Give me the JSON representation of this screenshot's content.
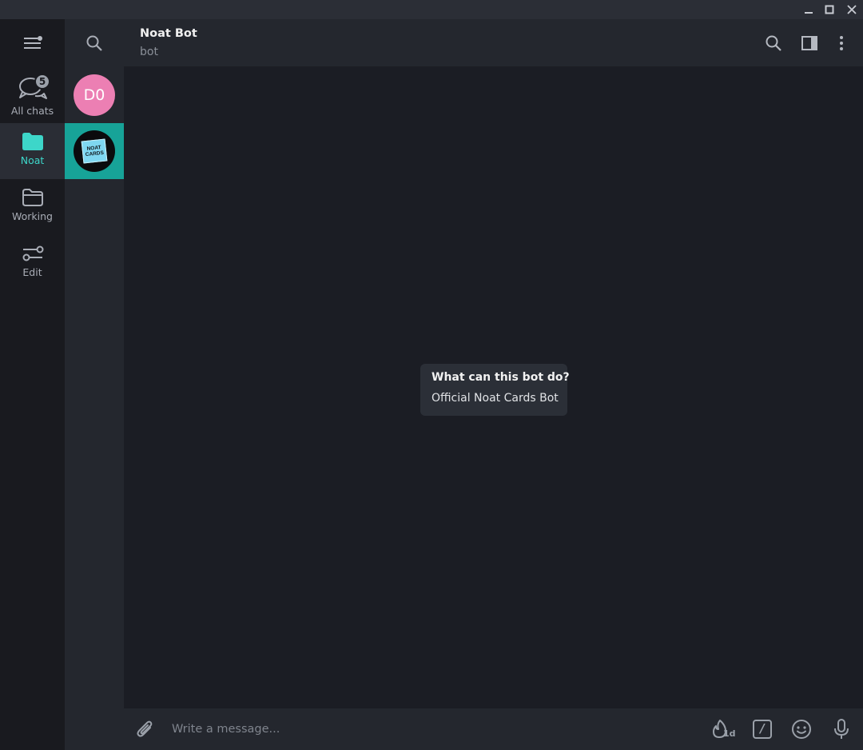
{
  "window": {
    "controls": [
      "minimize-icon",
      "maximize-icon",
      "close-icon"
    ]
  },
  "rail": {
    "menu_icon": "menu-icon",
    "items": [
      {
        "label": "All chats",
        "icon": "chats-icon",
        "badge": "5",
        "active": false
      },
      {
        "label": "Noat",
        "icon": "folder-filled-icon",
        "active": true
      },
      {
        "label": "Working",
        "icon": "folder-icon",
        "active": false
      },
      {
        "label": "Edit",
        "icon": "sliders-icon",
        "active": false
      }
    ]
  },
  "chatlist": {
    "search_icon": "search-icon",
    "chats": [
      {
        "avatar_text": "D0",
        "avatar_color": "#ec7fb3",
        "selected": false
      },
      {
        "avatar_logo_lines": [
          "NOAT",
          "CARDS"
        ],
        "avatar_color": "#7fd7f1",
        "selected": true
      }
    ]
  },
  "header": {
    "title": "Noat Bot",
    "status": "bot",
    "icons": [
      "search-icon",
      "side-panel-icon",
      "more-vertical-icon"
    ]
  },
  "bot_info": {
    "question": "What can this bot do?",
    "description": "Official Noat Cards Bot"
  },
  "composer": {
    "placeholder": "Write a message...",
    "icons": [
      "attach-icon",
      "timer-icon",
      "bot-commands-icon",
      "emoji-icon",
      "microphone-icon"
    ],
    "timer_label": "1d",
    "commands_label": "/"
  },
  "colors": {
    "accent": "#3dd6c9",
    "selected_chat": "#17a398",
    "background": "#1b1d24"
  }
}
